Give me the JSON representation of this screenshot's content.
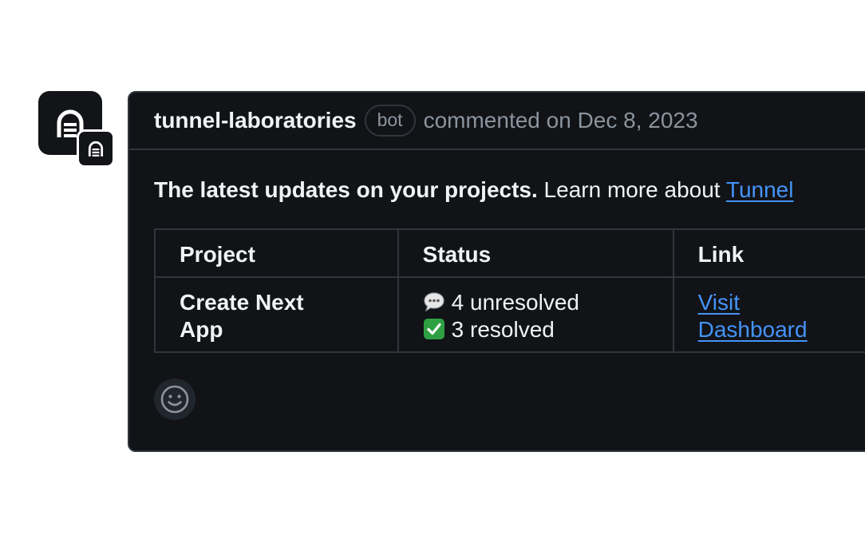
{
  "comment": {
    "author": "tunnel-laboratories",
    "badge": "bot",
    "meta": "commented on Dec 8, 2023",
    "intro_bold": "The latest updates on your projects.",
    "intro_text": "Learn more about",
    "intro_link": "Tunnel"
  },
  "table": {
    "headers": [
      "Project",
      "Status",
      "Link"
    ],
    "rows": [
      {
        "project_line1": "Create Next",
        "project_line2": "App",
        "status_unresolved": "4 unresolved",
        "status_resolved": "3 resolved",
        "link_line1": "Visit",
        "link_line2": "Dashboard"
      }
    ]
  },
  "icons": {
    "avatar": "tunnel-logo-icon",
    "badge": "tunnel-logo-icon",
    "unresolved": "speech-bubble-icon",
    "resolved": "check-mark-icon",
    "reaction": "smiley-icon"
  },
  "colors": {
    "background": "#111317",
    "border": "#30363d",
    "text": "#f0f3f6",
    "muted": "#8b949e",
    "link": "#4493f8",
    "check": "#2ea043"
  }
}
